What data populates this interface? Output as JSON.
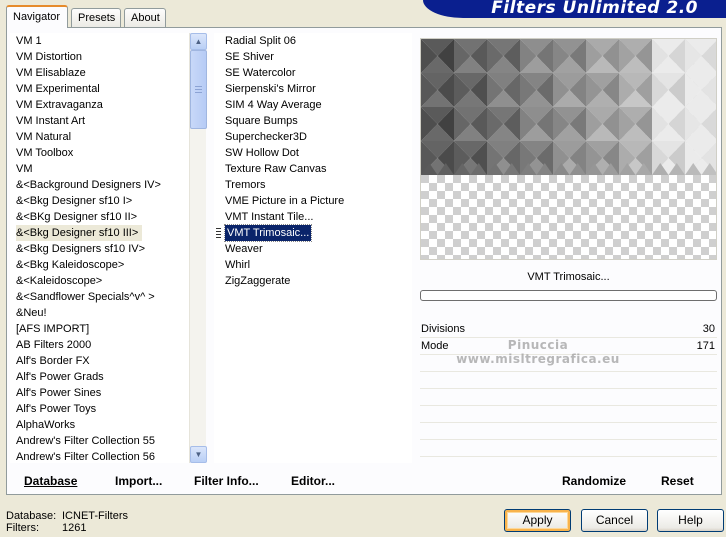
{
  "tabs": [
    {
      "label": "Navigator",
      "active": true
    },
    {
      "label": "Presets",
      "active": false
    },
    {
      "label": "About",
      "active": false
    }
  ],
  "title": "Filters Unlimited 2.0",
  "categories": [
    "VM 1",
    "VM Distortion",
    "VM Elisablaze",
    "VM Experimental",
    "VM Extravaganza",
    "VM Instant Art",
    "VM Natural",
    "VM Toolbox",
    "VM",
    "&<Background Designers IV>",
    "&<Bkg Designer sf10 I>",
    "&<BKg Designer sf10 II>",
    "&<Bkg Designer sf10 III>",
    "&<Bkg Designers sf10 IV>",
    "&<Bkg Kaleidoscope>",
    "&<Kaleidoscope>",
    "&<Sandflower Specials^v^ >",
    "&Neu!",
    "[AFS IMPORT]",
    "AB Filters 2000",
    "Alf's Border FX",
    "Alf's Power Grads",
    "Alf's Power Sines",
    "Alf's Power Toys",
    "AlphaWorks",
    "Andrew's Filter Collection 55",
    "Andrew's Filter Collection 56"
  ],
  "selected_category_index": 12,
  "filters": [
    "Radial Split 06",
    "SE Shiver",
    "SE Watercolor",
    "Sierpenski's Mirror",
    "SIM 4 Way Average",
    "Square Bumps",
    "Superchecker3D",
    "SW Hollow Dot",
    "Texture Raw Canvas",
    "Tremors",
    "VME Picture in a Picture",
    "VMT Instant Tile...",
    "VMT Trimosaic...",
    "Weaver",
    "Whirl",
    "ZigZaggerate"
  ],
  "selected_filter_index": 12,
  "footer_left": {
    "database": "Database",
    "import": "Import...",
    "filter_info": "Filter Info...",
    "editor": "Editor..."
  },
  "footer_right": {
    "randomize": "Randomize",
    "reset": "Reset"
  },
  "preview": {
    "filter_name": "VMT Trimosaic..."
  },
  "params": [
    {
      "label": "Divisions",
      "value": "30"
    },
    {
      "label": "Mode",
      "value": "171"
    }
  ],
  "watermark": {
    "line1": "Pinuccia",
    "line2": "www.misltregrafica.eu"
  },
  "status": {
    "database_label": "Database:",
    "database_value": "ICNET-Filters",
    "filters_label": "Filters:",
    "filters_value": "1261"
  },
  "buttons": {
    "apply": "Apply",
    "cancel": "Cancel",
    "help": "Help"
  }
}
